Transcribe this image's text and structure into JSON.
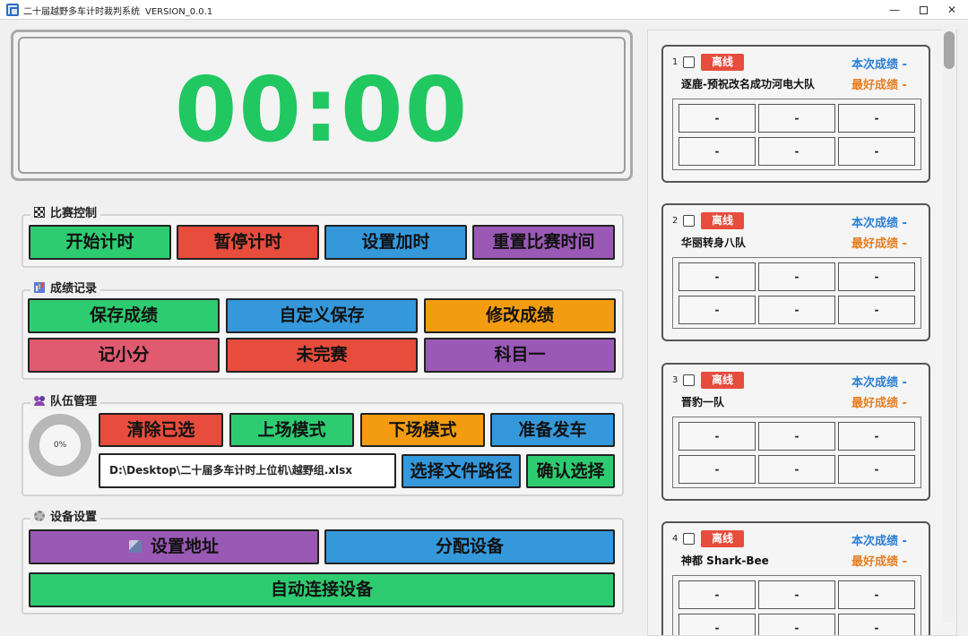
{
  "window": {
    "title": "二十届越野多车计时裁判系统",
    "version": "VERSION_0.0.1",
    "minimize_glyph": "—",
    "close_glyph": "✕"
  },
  "timer": {
    "display": "00:00"
  },
  "race_control": {
    "title": "比赛控制",
    "start": "开始计时",
    "pause": "暂停计时",
    "add_time": "设置加时",
    "reset": "重置比赛时间"
  },
  "score_record": {
    "title": "成绩记录",
    "save": "保存成绩",
    "custom_save": "自定义保存",
    "modify": "修改成绩",
    "minor_points": "记小分",
    "unfinished": "未完赛",
    "subject_one": "科目一"
  },
  "team_mgmt": {
    "title": "队伍管理",
    "progress_label": "0%",
    "progress_fraction": 0,
    "clear_selected": "清除已选",
    "enter_mode": "上场模式",
    "exit_mode": "下场模式",
    "ready_launch": "准备发车",
    "file_path": "D:\\Desktop\\二十届多车计时上位机\\越野组.xlsx",
    "choose_path": "选择文件路径",
    "confirm_select": "确认选择"
  },
  "device_settings": {
    "title": "设备设置",
    "set_address": "设置地址",
    "assign_device": "分配设备",
    "auto_connect": "自动连接设备"
  },
  "teams": [
    {
      "index": "1",
      "status": "离线",
      "name": "逐鹿-预祝改名成功河电大队",
      "current_label": "本次成绩 -",
      "best_label": "最好成绩 -",
      "cells": [
        "-",
        "-",
        "-",
        "-",
        "-",
        "-"
      ]
    },
    {
      "index": "2",
      "status": "离线",
      "name": "华丽转身八队",
      "current_label": "本次成绩 -",
      "best_label": "最好成绩 -",
      "cells": [
        "-",
        "-",
        "-",
        "-",
        "-",
        "-"
      ]
    },
    {
      "index": "3",
      "status": "离线",
      "name": "晋豹一队",
      "current_label": "本次成绩 -",
      "best_label": "最好成绩 -",
      "cells": [
        "-",
        "-",
        "-",
        "-",
        "-",
        "-"
      ]
    },
    {
      "index": "4",
      "status": "离线",
      "name": "神都 Shark-Bee",
      "current_label": "本次成绩 -",
      "best_label": "最好成绩 -",
      "cells": [
        "-",
        "-",
        "-",
        "-",
        "-",
        "-"
      ]
    }
  ]
}
